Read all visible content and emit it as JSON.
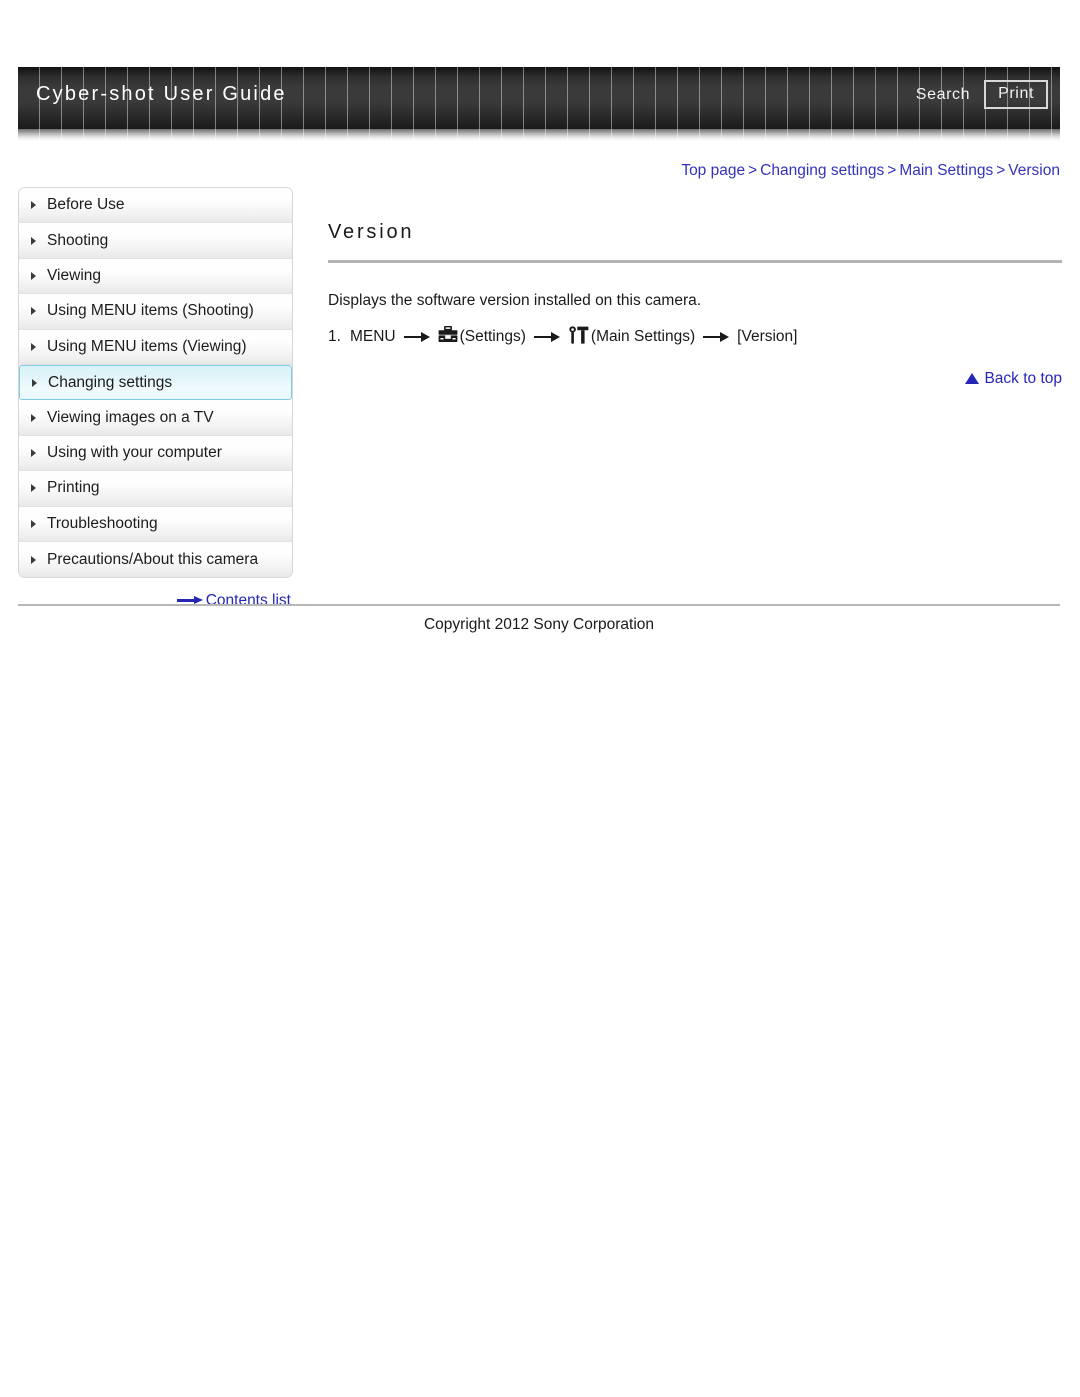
{
  "header": {
    "title": "Cyber-shot User Guide",
    "search_label": "Search",
    "print_label": "Print"
  },
  "breadcrumb": {
    "items": [
      "Top page",
      "Changing settings",
      "Main Settings",
      "Version"
    ],
    "separator": ">"
  },
  "sidebar": {
    "items": [
      {
        "label": "Before Use",
        "active": false
      },
      {
        "label": "Shooting",
        "active": false
      },
      {
        "label": "Viewing",
        "active": false
      },
      {
        "label": "Using MENU items (Shooting)",
        "active": false
      },
      {
        "label": "Using MENU items (Viewing)",
        "active": false
      },
      {
        "label": "Changing settings",
        "active": true
      },
      {
        "label": "Viewing images on a TV",
        "active": false
      },
      {
        "label": "Using with your computer",
        "active": false
      },
      {
        "label": "Printing",
        "active": false
      },
      {
        "label": "Troubleshooting",
        "active": false
      },
      {
        "label": "Precautions/About this camera",
        "active": false
      }
    ],
    "contents_link": "Contents list"
  },
  "main": {
    "title": "Version",
    "description": "Displays the software version installed on this camera.",
    "step": {
      "number": "1.",
      "menu_label": "MENU",
      "settings_icon": "toolbox-icon",
      "settings_label": "(Settings)",
      "main_settings_icon": "tools-icon",
      "main_settings_label": "(Main Settings)",
      "target_label": "[Version]"
    },
    "back_to_top": "Back to top"
  },
  "footer": {
    "copyright": "Copyright 2012 Sony Corporation"
  },
  "colors": {
    "link": "#2626b5",
    "breadcrumb": "#3333bb",
    "active_border": "#7fcbe0",
    "rule": "#b3b3b3"
  }
}
